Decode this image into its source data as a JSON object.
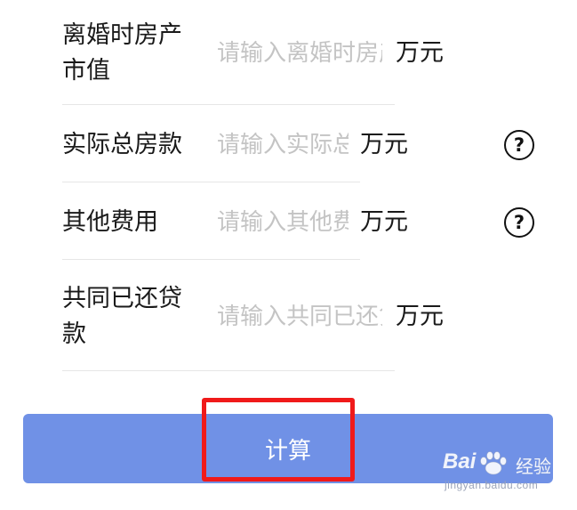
{
  "form": {
    "rows": [
      {
        "label": "离婚时房产市值",
        "placeholder": "请输入离婚时房产市值",
        "unit": "万元",
        "has_help": false
      },
      {
        "label": "实际总房款",
        "placeholder": "请输入实际总房款",
        "unit": "万元",
        "has_help": true
      },
      {
        "label": "其他费用",
        "placeholder": "请输入其他费用",
        "unit": "万元",
        "has_help": true
      },
      {
        "label": "共同已还贷款",
        "placeholder": "请输入共同已还贷款",
        "unit": "万元",
        "has_help": false
      }
    ],
    "help_glyph": "?",
    "submit_label": "计算"
  },
  "colors": {
    "button_bg": "#7091e6",
    "highlight": "#f01a1a",
    "placeholder": "#c4c4c4"
  },
  "watermark": {
    "logo": "Bai",
    "name": "经验",
    "url": "jingyan.baidu.com"
  }
}
